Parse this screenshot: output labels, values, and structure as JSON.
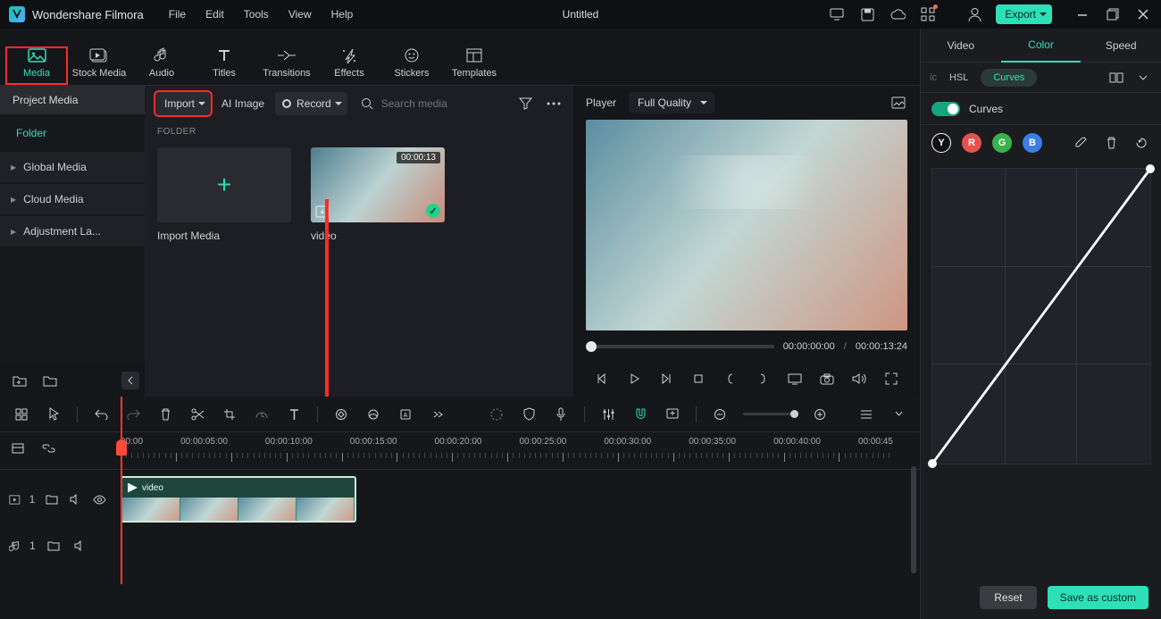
{
  "app": {
    "name": "Wondershare Filmora",
    "document": "Untitled"
  },
  "menu": {
    "file": "File",
    "edit": "Edit",
    "tools": "Tools",
    "view": "View",
    "help": "Help"
  },
  "header_btn": {
    "export": "Export"
  },
  "tabs": {
    "media": "Media",
    "stock": "Stock Media",
    "audio": "Audio",
    "titles": "Titles",
    "transitions": "Transitions",
    "effects": "Effects",
    "stickers": "Stickers",
    "templates": "Templates"
  },
  "sidebar": {
    "project": "Project Media",
    "folder": "Folder",
    "items": [
      "Global Media",
      "Cloud Media",
      "Adjustment La..."
    ]
  },
  "media": {
    "import": "Import",
    "ai": "AI Image",
    "record": "Record",
    "search_ph": "Search media",
    "section": "FOLDER",
    "cells": [
      {
        "caption": "Import Media"
      },
      {
        "caption": "video",
        "duration": "00:00:13"
      }
    ]
  },
  "preview": {
    "player": "Player",
    "quality": "Full Quality",
    "t_current": "00:00:00:00",
    "t_sep": "/",
    "t_total": "00:00:13:24"
  },
  "inspector": {
    "tabs": {
      "video": "Video",
      "color": "Color",
      "speed": "Speed"
    },
    "sub": {
      "ic": "ic",
      "hsl": "HSL",
      "curves": "Curves"
    },
    "toggle": "Curves",
    "channels": {
      "y": "Y",
      "r": "R",
      "g": "G",
      "b": "B"
    },
    "buttons": {
      "reset": "Reset",
      "save": "Save as custom"
    }
  },
  "timeline": {
    "ruler": [
      "00:00",
      "00:00:05:00",
      "00:00:10:00",
      "00:00:15:00",
      "00:00:20:00",
      "00:00:25:00",
      "00:00:30:00",
      "00:00:35:00",
      "00:00:40:00",
      "00:00:45"
    ],
    "track_v": "1",
    "track_a": "1",
    "clip_name": "video"
  }
}
